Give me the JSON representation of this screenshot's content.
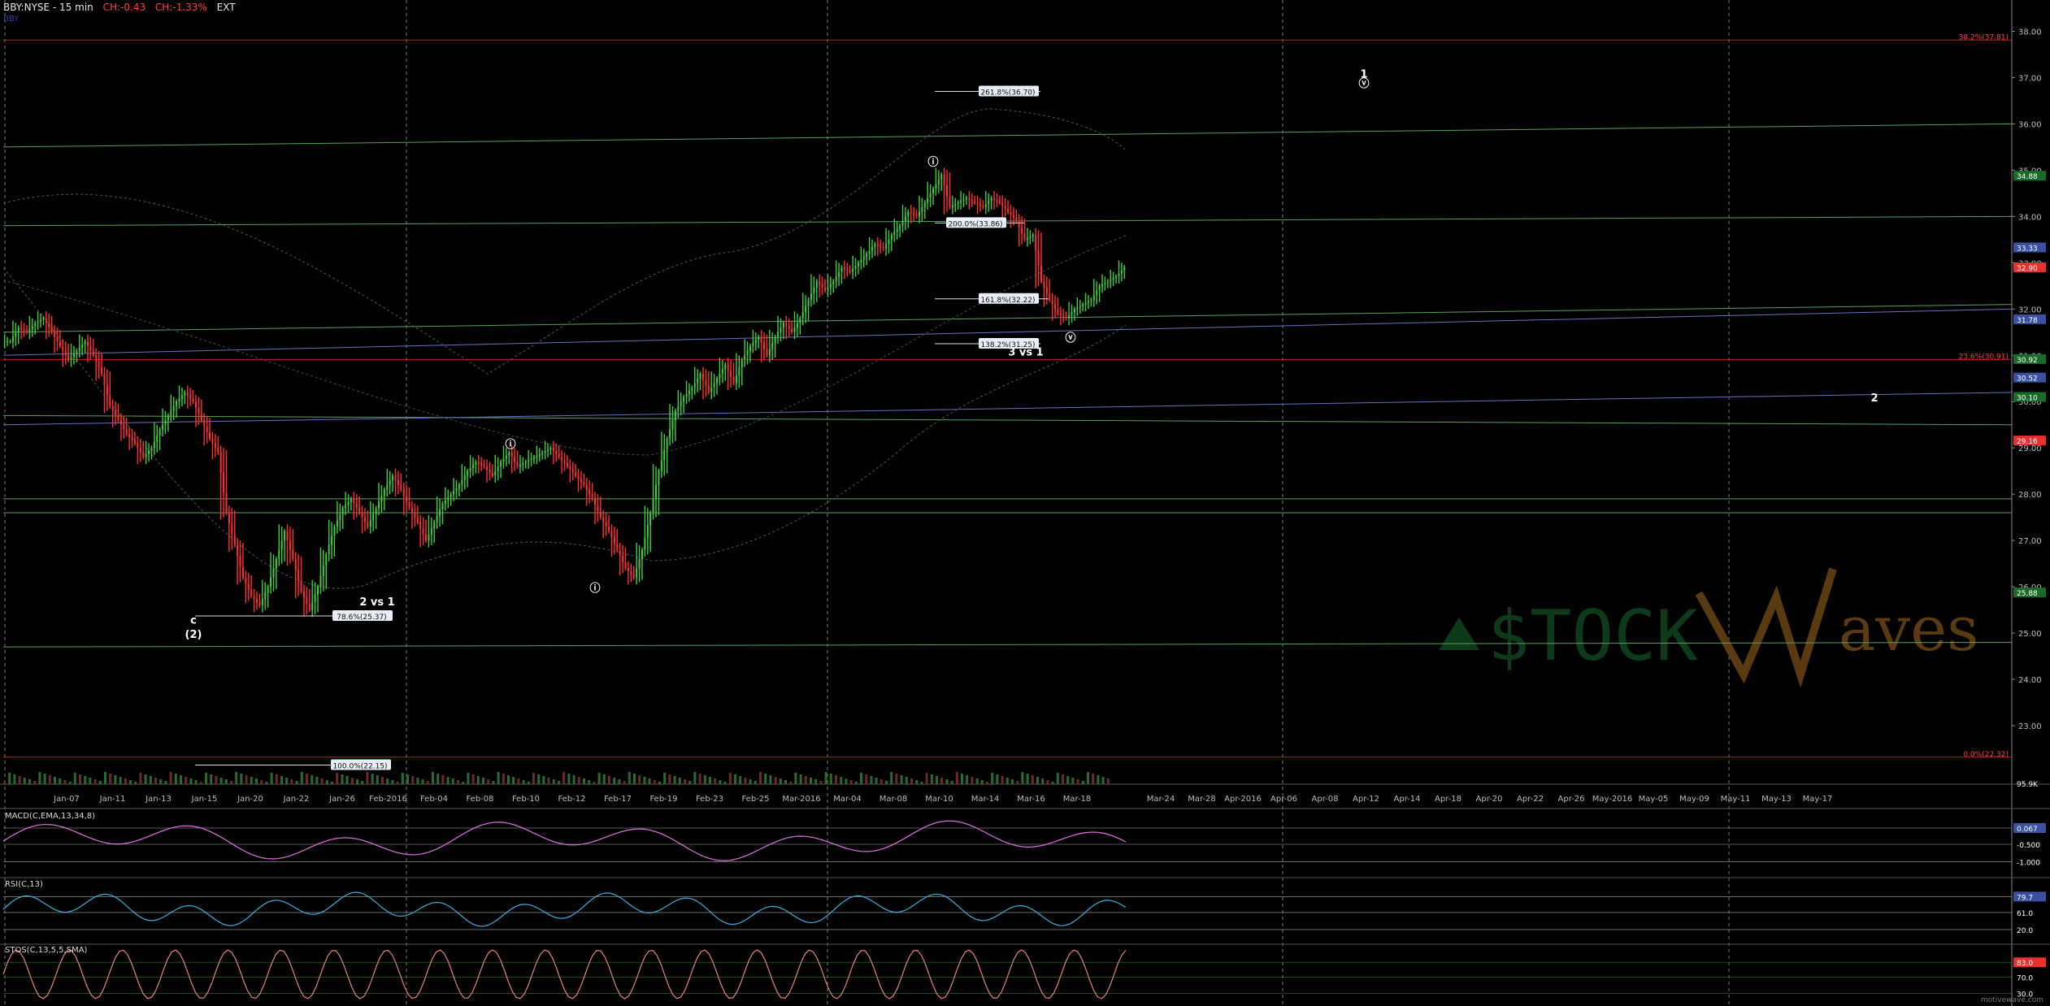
{
  "header": {
    "symbol": "BBY:NYSE - 15 min",
    "change": "CH:-0.43",
    "change_pct": "CH:-1.33%",
    "ext": "EXT",
    "overlay": "BBY"
  },
  "footer": {
    "credit": "motivewave.com"
  },
  "watermark": "$TOCK  Waves",
  "panes": {
    "macd": {
      "label": "MACD(C,EMA,13,34,8)",
      "ticks": [
        "0.067",
        "-0.500",
        "-1.000"
      ]
    },
    "rsi": {
      "label": "RSI(C,13)",
      "ticks": [
        "79.7",
        "61.0",
        "20.0"
      ]
    },
    "stoch": {
      "label": "STOS(C,13,5,5,SMA)",
      "ticks": [
        "83.0",
        "70.0",
        "30.0"
      ]
    }
  },
  "colors": {
    "candle_up": "#3ecf3e",
    "candle_down": "#ff3030",
    "wave_lines": "#5aa05a",
    "fib_lines": "#c02020",
    "bbands": "#555555",
    "indicator": "#3aaee0",
    "stoch_line": "#e88080",
    "watermark_green": "#0d3b1a",
    "watermark_brown": "#5a3a10"
  },
  "chart_data": {
    "type": "candlestick",
    "ylim": [
      22.0,
      38.5
    ],
    "yticks": [
      "38.00",
      "37.00",
      "36.00",
      "35.00",
      "34.00",
      "33.00",
      "32.00",
      "31.00",
      "30.00",
      "29.00",
      "28.00",
      "27.00",
      "26.00",
      "25.00",
      "24.00",
      "23.00"
    ],
    "xticks": [
      "Jan-07",
      "Jan-11",
      "Jan-13",
      "Jan-15",
      "Jan-20",
      "Jan-22",
      "Jan-26",
      "Feb-2016",
      "Feb-04",
      "Feb-08",
      "Feb-10",
      "Feb-12",
      "Feb-17",
      "Feb-19",
      "Feb-23",
      "Feb-25",
      "Mar-2016",
      "Mar-04",
      "Mar-08",
      "Mar-10",
      "Mar-14",
      "Mar-16",
      "Mar-18",
      "Mar-24",
      "Mar-28",
      "Apr-2016",
      "Apr-06",
      "Apr-08",
      "Apr-12",
      "Apr-14",
      "Apr-18",
      "Apr-20",
      "Apr-22",
      "Apr-26",
      "May-2016",
      "May-05",
      "May-09",
      "May-11",
      "May-13",
      "May-17"
    ],
    "price_series": [
      31.3,
      31.6,
      31.5,
      31.7,
      31.8,
      31.5,
      31.2,
      30.9,
      31.1,
      31.3,
      31.0,
      30.6,
      29.9,
      29.6,
      29.3,
      29.1,
      28.8,
      29.0,
      29.4,
      29.7,
      30.0,
      30.2,
      30.0,
      29.6,
      29.2,
      28.9,
      27.6,
      26.9,
      26.2,
      25.8,
      25.6,
      26.0,
      26.6,
      27.2,
      26.6,
      25.9,
      25.5,
      26.0,
      26.7,
      27.3,
      27.7,
      27.9,
      27.6,
      27.3,
      27.7,
      28.1,
      28.4,
      28.1,
      27.7,
      27.4,
      27.0,
      27.4,
      27.8,
      28.0,
      28.2,
      28.5,
      28.7,
      28.6,
      28.4,
      28.7,
      28.9,
      28.6,
      28.7,
      28.8,
      28.9,
      29.0,
      28.8,
      28.6,
      28.4,
      28.2,
      27.9,
      27.5,
      27.2,
      26.8,
      26.4,
      26.2,
      26.8,
      27.6,
      28.5,
      29.2,
      29.8,
      30.1,
      30.3,
      30.6,
      30.2,
      30.5,
      30.8,
      30.4,
      30.9,
      31.2,
      31.4,
      31.0,
      31.4,
      31.7,
      31.5,
      31.8,
      32.2,
      32.6,
      32.4,
      32.6,
      32.9,
      32.8,
      33.0,
      33.2,
      33.4,
      33.3,
      33.6,
      33.8,
      34.1,
      34.0,
      34.3,
      34.6,
      34.9,
      34.2,
      34.3,
      34.4,
      34.3,
      34.2,
      34.4,
      34.3,
      34.1,
      33.9,
      33.5,
      33.6,
      32.6,
      32.2,
      31.9,
      31.8,
      32.0,
      32.1,
      32.2,
      32.5,
      32.6,
      32.7,
      32.9
    ],
    "green_channel_lines": [
      {
        "from": [
          "Jan-04",
          35.5
        ],
        "to": [
          "May-19",
          36.0
        ]
      },
      {
        "from": [
          "Jan-04",
          33.8
        ],
        "to": [
          "May-19",
          34.0
        ]
      },
      {
        "from": [
          "Jan-04",
          31.5
        ],
        "to": [
          "May-19",
          32.1
        ]
      },
      {
        "from": [
          "Jan-04",
          29.7
        ],
        "to": [
          "May-19",
          29.5
        ]
      },
      {
        "from": [
          "Jan-04",
          27.9
        ],
        "to": [
          "May-19",
          27.9
        ]
      },
      {
        "from": [
          "Jan-04",
          27.6
        ],
        "to": [
          "May-19",
          27.6
        ]
      },
      {
        "from": [
          "Jan-04",
          24.7
        ],
        "to": [
          "May-19",
          24.8
        ]
      }
    ],
    "blue_trend_lines": [
      {
        "from": [
          "Jan-04",
          31.0
        ],
        "to": [
          "May-19",
          32.0
        ]
      },
      {
        "from": [
          "Jan-04",
          29.5
        ],
        "to": [
          "May-19",
          30.2
        ]
      }
    ],
    "fib_lines": [
      {
        "label": "38.2%(37.81)",
        "value": 37.81
      },
      {
        "label": "23.6%(30.91)",
        "value": 30.91
      },
      {
        "label": "0.0%(22.32)",
        "value": 22.32
      }
    ],
    "extension_labels": [
      {
        "label": "261.8%(36.70)",
        "value": 36.7
      },
      {
        "label": "200.0%(33.86)",
        "value": 33.86
      },
      {
        "label": "161.8%(32.22)",
        "value": 32.22
      },
      {
        "label": "138.2%(31.25)",
        "value": 31.25
      },
      {
        "label": "78.6%(25.37)",
        "value": 25.37
      },
      {
        "label": "100.0%(22.15)",
        "value": 22.15
      }
    ],
    "wave_labels": [
      {
        "text": "1",
        "value": 37.0
      },
      {
        "text": "ⓥ",
        "value": 36.8
      },
      {
        "text": "2",
        "value": 30.0
      },
      {
        "text": "ⓘ",
        "value": 35.1
      },
      {
        "text": "ⓘ",
        "value": 29.0
      },
      {
        "text": "ⓘ",
        "value": 25.9
      },
      {
        "text": "ⓥ",
        "value": 31.3
      },
      {
        "text": "3 vs 1",
        "value": 31.0
      },
      {
        "text": "2 vs 1",
        "value": 25.6
      },
      {
        "text": "c",
        "value": 25.2
      },
      {
        "text": "(2)",
        "value": 24.9
      }
    ],
    "right_axis_tags": [
      {
        "label": "34.88",
        "value": 34.88
      },
      {
        "label": "33.33",
        "value": 33.33
      },
      {
        "label": "32.90",
        "value": 32.9
      },
      {
        "label": "31.78",
        "value": 31.78
      },
      {
        "label": "30.92",
        "value": 30.92
      },
      {
        "label": "30.52",
        "value": 30.52
      },
      {
        "label": "30.10",
        "value": 30.1
      },
      {
        "label": "29.16",
        "value": 29.16
      },
      {
        "label": "25.88",
        "value": 25.88
      }
    ],
    "volume_label": "95.9K"
  }
}
